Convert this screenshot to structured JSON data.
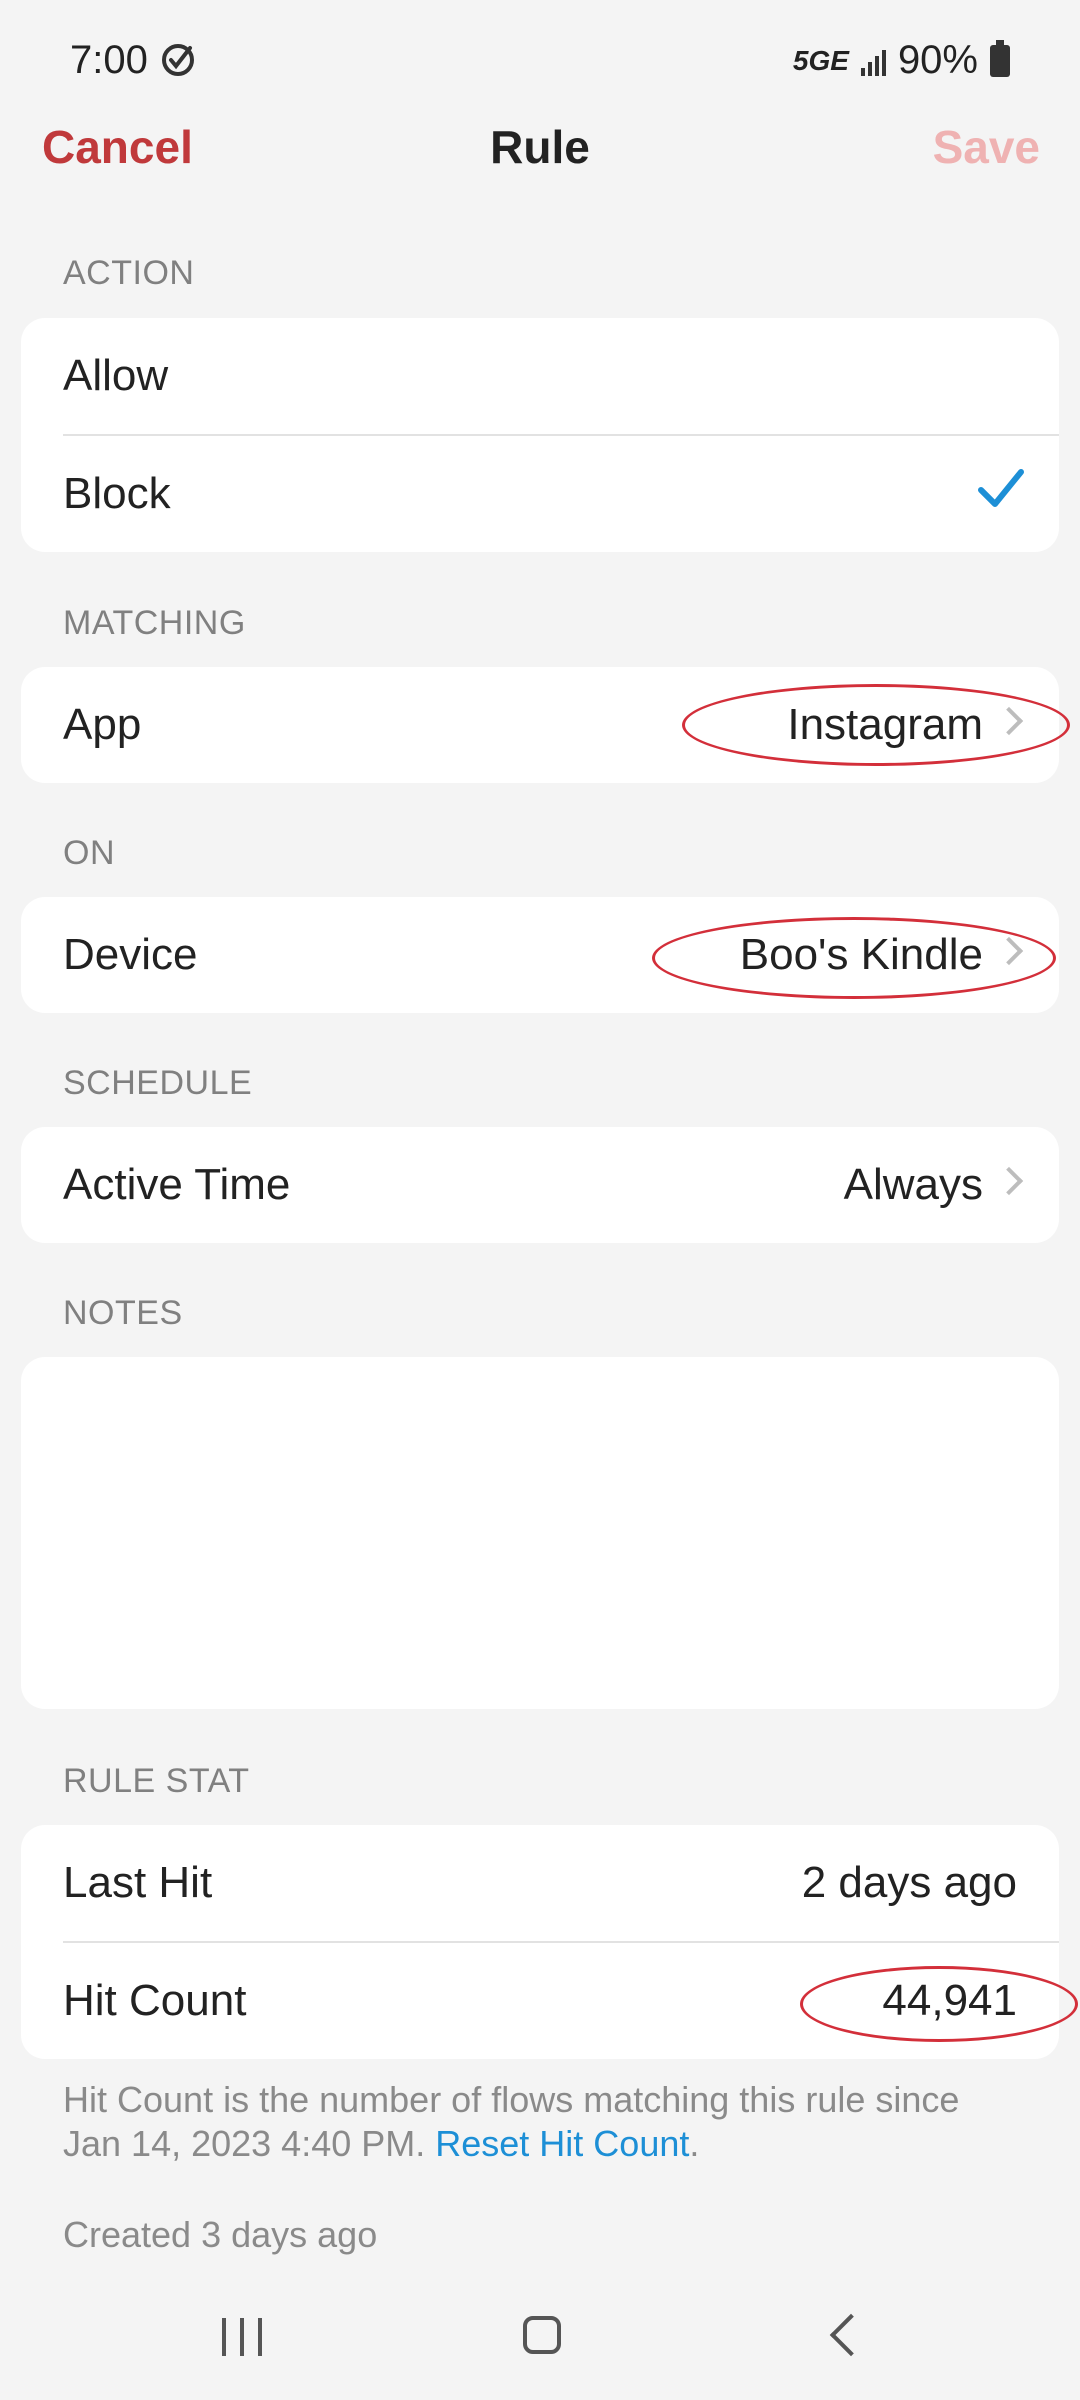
{
  "status_bar": {
    "time": "7:00",
    "network": "5GE",
    "battery": "90%"
  },
  "header": {
    "cancel": "Cancel",
    "title": "Rule",
    "save": "Save"
  },
  "action": {
    "header": "ACTION",
    "options": [
      {
        "label": "Allow",
        "selected": false
      },
      {
        "label": "Block",
        "selected": true
      }
    ]
  },
  "matching": {
    "header": "MATCHING",
    "label": "App",
    "value": "Instagram"
  },
  "on": {
    "header": "ON",
    "label": "Device",
    "value": "Boo's Kindle"
  },
  "schedule": {
    "header": "SCHEDULE",
    "label": "Active Time",
    "value": "Always"
  },
  "notes": {
    "header": "NOTES",
    "value": ""
  },
  "rule_stat": {
    "header": "RULE STAT",
    "last_hit_label": "Last Hit",
    "last_hit_value": "2 days ago",
    "hit_count_label": "Hit Count",
    "hit_count_value": "44,941",
    "footnote": "Hit Count is the number of flows matching this rule since Jan 14, 2023 4:40 PM. ",
    "reset_link": "Reset Hit Count",
    "footnote_end": "."
  },
  "created": "Created 3 days ago",
  "colors": {
    "accent_red": "#c0393b",
    "save_disabled": "#efb2b2",
    "check_blue": "#1d8fd6",
    "annotation_red": "#d32f3a"
  }
}
